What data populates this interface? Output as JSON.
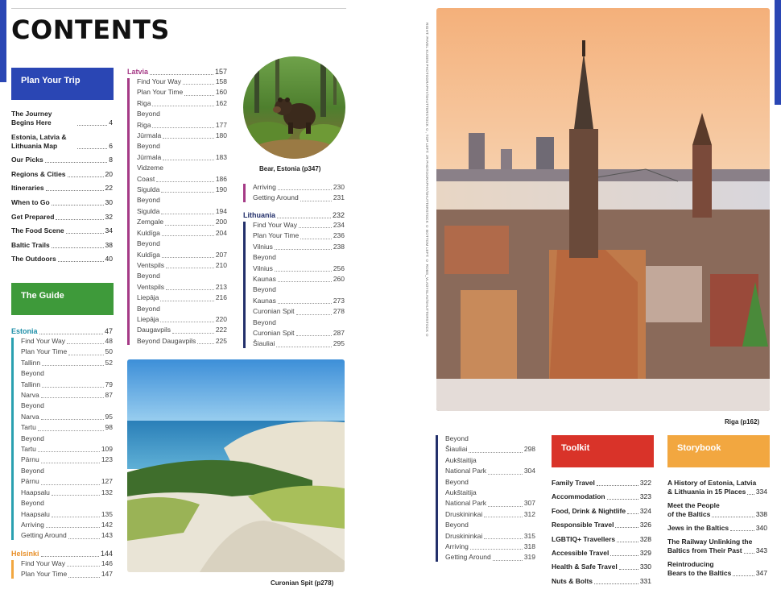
{
  "title": "CONTENTS",
  "colors": {
    "blue": "#2a46b4",
    "green": "#3e9a3a",
    "magenta": "#a53a86",
    "orange": "#f2a740",
    "red": "#d93329",
    "navy": "#23306b"
  },
  "plan": {
    "label": "Plan Your Trip",
    "items": [
      {
        "label": "The Journey Begins Here",
        "page": "4"
      },
      {
        "label": "Estonia, Latvia & Lithuania Map",
        "page": "6"
      },
      {
        "label": "Our Picks",
        "page": "8"
      },
      {
        "label": "Regions & Cities",
        "page": "20"
      },
      {
        "label": "Itineraries",
        "page": "22"
      },
      {
        "label": "When to Go",
        "page": "30"
      },
      {
        "label": "Get Prepared",
        "page": "32"
      },
      {
        "label": "The Food Scene",
        "page": "34"
      },
      {
        "label": "Baltic Trails",
        "page": "38"
      },
      {
        "label": "The Outdoors",
        "page": "40"
      }
    ]
  },
  "guide": {
    "label": "The Guide",
    "estonia": {
      "name": "Estonia",
      "page": "47",
      "items": [
        {
          "label": "Find Your Way",
          "page": "48"
        },
        {
          "label": "Plan Your Time",
          "page": "50"
        },
        {
          "label": "Tallinn",
          "page": "52"
        },
        {
          "label": "Beyond",
          "page": ""
        },
        {
          "label": "Tallinn",
          "page": "79"
        },
        {
          "label": "Narva",
          "page": "87"
        },
        {
          "label": "Beyond",
          "page": ""
        },
        {
          "label": "Narva",
          "page": "95"
        },
        {
          "label": "Tartu",
          "page": "98"
        },
        {
          "label": "Beyond",
          "page": ""
        },
        {
          "label": "Tartu",
          "page": "109"
        },
        {
          "label": "Pärnu",
          "page": "123"
        },
        {
          "label": "Beyond",
          "page": ""
        },
        {
          "label": "Pärnu",
          "page": "127"
        },
        {
          "label": "Haapsalu",
          "page": "132"
        },
        {
          "label": "Beyond",
          "page": ""
        },
        {
          "label": "Haapsalu",
          "page": "135"
        },
        {
          "label": "Arriving",
          "page": "142"
        },
        {
          "label": "Getting Around",
          "page": "143"
        }
      ]
    },
    "helsinki": {
      "name": "Helsinki",
      "page": "144",
      "items": [
        {
          "label": "Find Your Way",
          "page": "146"
        },
        {
          "label": "Plan Your Time",
          "page": "147"
        }
      ]
    },
    "latvia": {
      "name": "Latvia",
      "page": "157",
      "items": [
        {
          "label": "Find Your Way",
          "page": "158"
        },
        {
          "label": "Plan Your Time",
          "page": "160"
        },
        {
          "label": "Riga",
          "page": "162"
        },
        {
          "label": "Beyond",
          "page": ""
        },
        {
          "label": "Riga",
          "page": "177"
        },
        {
          "label": "Jūrmala",
          "page": "180"
        },
        {
          "label": "Beyond",
          "page": ""
        },
        {
          "label": "Jūrmala",
          "page": "183"
        },
        {
          "label": "Vidzeme",
          "page": ""
        },
        {
          "label": "Coast",
          "page": "186"
        },
        {
          "label": "Sigulda",
          "page": "190"
        },
        {
          "label": "Beyond",
          "page": ""
        },
        {
          "label": "Sigulda",
          "page": "194"
        },
        {
          "label": "Zemgale",
          "page": "200"
        },
        {
          "label": "Kuldīga",
          "page": "204"
        },
        {
          "label": "Beyond",
          "page": ""
        },
        {
          "label": "Kuldīga",
          "page": "207"
        },
        {
          "label": "Ventspils",
          "page": "210"
        },
        {
          "label": "Beyond",
          "page": ""
        },
        {
          "label": "Ventspils",
          "page": "213"
        },
        {
          "label": "Liepāja",
          "page": "216"
        },
        {
          "label": "Beyond",
          "page": ""
        },
        {
          "label": "Liepāja",
          "page": "220"
        },
        {
          "label": "Daugavpils",
          "page": "222"
        },
        {
          "label": "Beyond Daugavpils",
          "page": "225"
        }
      ]
    },
    "latvia_tail": {
      "items": [
        {
          "label": "Arriving",
          "page": "230"
        },
        {
          "label": "Getting Around",
          "page": "231"
        }
      ]
    },
    "lithuania": {
      "name": "Lithuania",
      "page": "232",
      "items": [
        {
          "label": "Find Your Way",
          "page": "234"
        },
        {
          "label": "Plan Your Time",
          "page": "236"
        },
        {
          "label": "Vilnius",
          "page": "238"
        },
        {
          "label": "Beyond",
          "page": ""
        },
        {
          "label": "Vilnius",
          "page": "256"
        },
        {
          "label": "Kaunas",
          "page": "260"
        },
        {
          "label": "Beyond",
          "page": ""
        },
        {
          "label": "Kaunas",
          "page": "273"
        },
        {
          "label": "Curonian Spit",
          "page": "278"
        },
        {
          "label": "Beyond",
          "page": ""
        },
        {
          "label": "Curonian Spit",
          "page": "287"
        },
        {
          "label": "Šiauliai",
          "page": "295"
        }
      ]
    },
    "lithuania_tail": {
      "items": [
        {
          "label": "Beyond",
          "page": ""
        },
        {
          "label": "Šiauliai",
          "page": "298"
        },
        {
          "label": "Aukštaitija",
          "page": ""
        },
        {
          "label": "National Park",
          "page": "304"
        },
        {
          "label": "Beyond",
          "page": ""
        },
        {
          "label": "Aukštaitija",
          "page": ""
        },
        {
          "label": "National Park",
          "page": "307"
        },
        {
          "label": "Druskininkai",
          "page": "312"
        },
        {
          "label": "Beyond",
          "page": ""
        },
        {
          "label": "Druskininkai",
          "page": "315"
        },
        {
          "label": "Arriving",
          "page": "318"
        },
        {
          "label": "Getting Around",
          "page": "319"
        }
      ]
    }
  },
  "toolkit": {
    "label": "Toolkit",
    "items": [
      {
        "label": "Family Travel",
        "page": "322"
      },
      {
        "label": "Accommodation",
        "page": "323"
      },
      {
        "label": "Food, Drink & Nightlife",
        "page": "324"
      },
      {
        "label": "Responsible Travel",
        "page": "326"
      },
      {
        "label": "LGBTIQ+ Travellers",
        "page": "328"
      },
      {
        "label": "Accessible Travel",
        "page": "329"
      },
      {
        "label": "Health & Safe Travel",
        "page": "330"
      },
      {
        "label": "Nuts & Bolts",
        "page": "331"
      }
    ]
  },
  "storybook": {
    "label": "Storybook",
    "items": [
      {
        "label1": "A History of Estonia, Latvia",
        "label2": "& Lithuania in 15 Places",
        "page": "334"
      },
      {
        "label1": "Meet the People",
        "label2": "of the Baltics",
        "page": "338"
      },
      {
        "label1": "Jews in the Baltics",
        "label2": "",
        "page": "340"
      },
      {
        "label1": "The Railway Unlinking the",
        "label2": "Baltics from Their Past",
        "page": "343"
      },
      {
        "label1": "Reintroducing",
        "label2": "Bears to the Baltics",
        "page": "347"
      }
    ]
  },
  "captions": {
    "bear": "Bear, Estonia (p347)",
    "spit": "Curonian Spit (p278)",
    "riga": "Riga (p162)"
  },
  "credit": "RIGHT: PAVEL KUSEN PHOTOGRAPHY/SHUTTERSTOCK ©, TOP LEFT: JR PHOTOGRAPHY/SHUTTERSTOCK © BOTTOM LEFT: © ROBS_VLADYSLAV/SHUTTERSTOCK ©"
}
